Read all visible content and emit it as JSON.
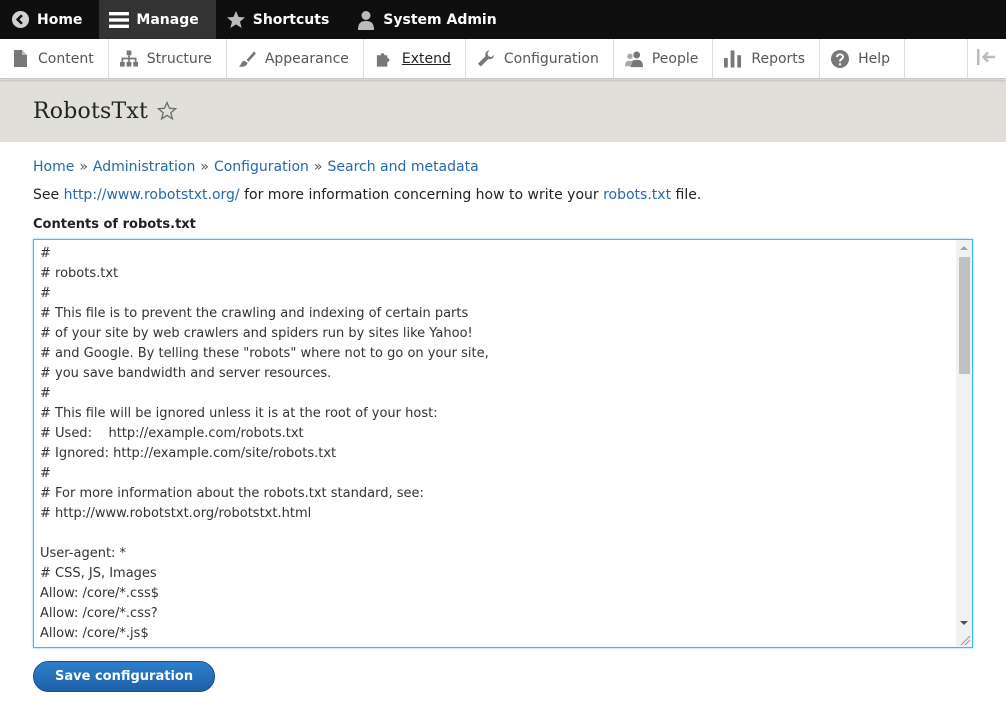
{
  "toolbar": {
    "items": [
      {
        "label": "Home",
        "icon": "back-arrow-icon"
      },
      {
        "label": "Manage",
        "icon": "hamburger-icon"
      },
      {
        "label": "Shortcuts",
        "icon": "star-icon"
      },
      {
        "label": "System Admin",
        "icon": "user-icon"
      }
    ]
  },
  "tray": {
    "items": [
      {
        "label": "Content",
        "icon": "page-icon"
      },
      {
        "label": "Structure",
        "icon": "sitemap-icon"
      },
      {
        "label": "Appearance",
        "icon": "brush-icon"
      },
      {
        "label": "Extend",
        "icon": "puzzle-icon"
      },
      {
        "label": "Configuration",
        "icon": "wrench-icon"
      },
      {
        "label": "People",
        "icon": "people-icon"
      },
      {
        "label": "Reports",
        "icon": "bar-chart-icon"
      },
      {
        "label": "Help",
        "icon": "help-icon"
      }
    ],
    "toggle_icon": "collapse-sidebar-icon"
  },
  "page": {
    "title": "RobotsTxt"
  },
  "breadcrumb": {
    "items": [
      "Home",
      "Administration",
      "Configuration",
      "Search and metadata"
    ],
    "separator": "»"
  },
  "description": {
    "before": "See ",
    "link1": "http://www.robotstxt.org/",
    "middle": " for more information concerning how to write your ",
    "link2": "robots.txt",
    "after": " file."
  },
  "field": {
    "label": "Contents of robots.txt",
    "lines": [
      "#",
      "# robots.txt",
      "#",
      "# This file is to prevent the crawling and indexing of certain parts",
      "# of your site by web crawlers and spiders run by sites like Yahoo!",
      "# and Google. By telling these \"robots\" where not to go on your site,",
      "# you save bandwidth and server resources.",
      "#",
      "# This file will be ignored unless it is at the root of your host:",
      "# Used:    http://example.com/robots.txt",
      "# Ignored: http://example.com/site/robots.txt",
      "#",
      "# For more information about the robots.txt standard, see:",
      "# http://www.robotstxt.org/robotstxt.html",
      "",
      "User-agent: *",
      "# CSS, JS, Images",
      "Allow: /core/*.css$",
      "Allow: /core/*.css?",
      "Allow: /core/*.js$"
    ]
  },
  "actions": {
    "save_label": "Save configuration"
  },
  "colors": {
    "link": "#2469a8",
    "toolbar_bg": "#0f0f0f",
    "header_bg": "#e0e0d8",
    "focus_border": "#40b6ff",
    "button": "#1e5fa8"
  }
}
